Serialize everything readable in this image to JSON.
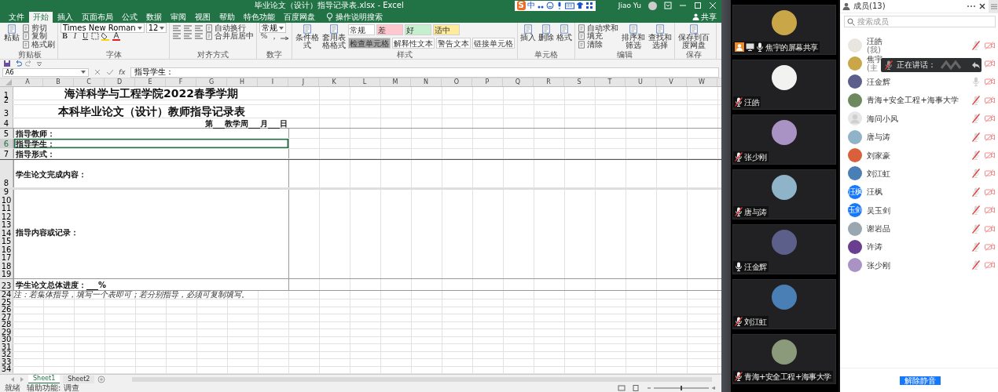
{
  "excel": {
    "title": "毕业论文（设计）指导记录表.xlsx - Excel",
    "ime": {
      "logo": "S",
      "mode": "中"
    },
    "user": "Jiao Yu",
    "share": "共享",
    "tabs": [
      {
        "label": "文件",
        "selected": false
      },
      {
        "label": "开始",
        "selected": true
      },
      {
        "label": "插入",
        "selected": false
      },
      {
        "label": "页面布局",
        "selected": false
      },
      {
        "label": "公式",
        "selected": false
      },
      {
        "label": "数据",
        "selected": false
      },
      {
        "label": "审阅",
        "selected": false
      },
      {
        "label": "视图",
        "selected": false
      },
      {
        "label": "帮助",
        "selected": false
      },
      {
        "label": "特色功能",
        "selected": false
      },
      {
        "label": "百度网盘",
        "selected": false
      }
    ],
    "tell_me": "操作说明搜索",
    "ribbon": [
      {
        "label": "剪贴板",
        "kind": "clipboard",
        "items": [
          {
            "kind": "large",
            "label": "粘贴"
          },
          {
            "kind": "stack",
            "lines": [
              [
                {
                  "kind": "small",
                  "label": "剪切"
                }
              ],
              [
                {
                  "kind": "small",
                  "label": "复制"
                }
              ],
              [
                {
                  "kind": "small",
                  "label": "格式刷"
                }
              ]
            ]
          }
        ]
      },
      {
        "label": "字体",
        "kind": "font",
        "items": [
          {
            "kind": "stack",
            "lines": [
              [
                {
                  "kind": "field",
                  "label": "Times New Roman"
                },
                {
                  "kind": "field",
                  "label": "12"
                }
              ],
              [
                {
                  "kind": "format",
                  "label": "B"
                },
                {
                  "kind": "format",
                  "label": "I"
                },
                {
                  "kind": "format",
                  "label": "U"
                }
              ]
            ]
          }
        ]
      },
      {
        "label": "对齐方式",
        "kind": "alignment",
        "items": [
          {
            "kind": "stack",
            "lines": [
              [
                {
                  "kind": "small",
                  "label": "自动换行"
                }
              ],
              [
                {
                  "kind": "small",
                  "label": "合并后居中"
                }
              ]
            ]
          }
        ]
      },
      {
        "label": "数字",
        "kind": "number",
        "items": [
          {
            "kind": "stack",
            "lines": [
              [
                {
                  "kind": "field",
                  "label": "常规"
                }
              ],
              [
                {
                  "kind": "format",
                  "label": "%"
                },
                {
                  "kind": "format",
                  "label": ","
                }
              ]
            ]
          }
        ]
      },
      {
        "label": "样式",
        "kind": "styles",
        "items": [
          {
            "kind": "large",
            "label": "条件格式"
          },
          {
            "kind": "large",
            "label": "套用表格格式"
          },
          {
            "kind": "stack",
            "lines": [
              [
                {
                  "kind": "style",
                  "label": "常规",
                  "color": "#ffffff"
                },
                {
                  "kind": "style",
                  "label": "差",
                  "color": "#ffc7ce"
                },
                {
                  "kind": "style",
                  "label": "好",
                  "color": "#c6efce"
                },
                {
                  "kind": "style",
                  "label": "适中",
                  "color": "#ffeb9c"
                }
              ],
              [
                {
                  "kind": "style",
                  "label": "检查单元格",
                  "color": "#a5a5a5"
                },
                {
                  "kind": "style",
                  "label": "解释性文本",
                  "color": "#ffffff"
                },
                {
                  "kind": "style",
                  "label": "警告文本",
                  "color": "#ffffff"
                },
                {
                  "kind": "style",
                  "label": "链接单元格",
                  "color": "#ffffff"
                }
              ]
            ]
          }
        ]
      },
      {
        "label": "单元格",
        "kind": "cells",
        "items": [
          {
            "kind": "large",
            "label": "插入"
          },
          {
            "kind": "large",
            "label": "删除"
          },
          {
            "kind": "large",
            "label": "格式"
          }
        ]
      },
      {
        "label": "编辑",
        "kind": "editing",
        "items": [
          {
            "kind": "stack",
            "lines": [
              [
                {
                  "kind": "small",
                  "label": "自动求和"
                }
              ],
              [
                {
                  "kind": "small",
                  "label": "填充"
                }
              ],
              [
                {
                  "kind": "small",
                  "label": "清除"
                }
              ]
            ]
          },
          {
            "kind": "large",
            "label": "排序和筛选"
          },
          {
            "kind": "large",
            "label": "查找和选择"
          }
        ]
      },
      {
        "label": "保存",
        "kind": "save",
        "items": [
          {
            "kind": "large",
            "label": "保存到百度网盘"
          }
        ]
      }
    ],
    "name_box": "A6",
    "function_label": "fx",
    "formula": "指导学生：",
    "columns": [
      "A",
      "B",
      "C",
      "D",
      "E",
      "F",
      "G",
      "H",
      "I",
      "J",
      "K",
      "L",
      "M",
      "N",
      "O",
      "P",
      "Q",
      "R",
      "S",
      "T",
      "U",
      "V",
      "W"
    ],
    "rows": [
      {
        "number": "1",
        "kind": "title",
        "text": "海洋科学与工程学院2022春季学期",
        "selected": false
      },
      {
        "number": "2",
        "kind": "spacer",
        "selected": false
      },
      {
        "number": "3",
        "kind": "title",
        "text": "本科毕业论文（设计）教师指导记录表",
        "selected": false
      },
      {
        "number": "4",
        "kind": "date",
        "text": "第___教学周___月___日",
        "selected": false
      },
      {
        "number": "5",
        "kind": "field",
        "text": "指导教师：",
        "selected": false
      },
      {
        "number": "6",
        "kind": "field",
        "text": "指导学生：",
        "selected": true
      },
      {
        "number": "7",
        "kind": "field",
        "text": "指导形式：",
        "selected": false
      },
      {
        "number": "8",
        "kind": "section",
        "text": "学生论文完成内容：",
        "selected": false
      },
      {
        "number": "9",
        "kind": "body-top",
        "selected": false
      },
      {
        "number": "10",
        "kind": "body",
        "selected": false
      },
      {
        "number": "11",
        "kind": "body",
        "selected": false
      },
      {
        "number": "12",
        "kind": "body",
        "selected": false
      },
      {
        "number": "13",
        "kind": "body",
        "selected": false
      },
      {
        "number": "14",
        "kind": "body",
        "text": "指导内容或记录：",
        "selected": false
      },
      {
        "number": "15",
        "kind": "body",
        "selected": false
      },
      {
        "number": "16",
        "kind": "body",
        "selected": false
      },
      {
        "number": "17",
        "kind": "body",
        "selected": false
      },
      {
        "number": "18",
        "kind": "body",
        "selected": false
      },
      {
        "number": "19",
        "kind": "body",
        "selected": false
      },
      {
        "number": "23",
        "kind": "progress",
        "text": "学生论文总体进度：___%",
        "selected": false
      },
      {
        "number": "24",
        "kind": "note",
        "text": "注：若集体指导，填写一个表即可；若分别指导，必须可复制填写。",
        "selected": false
      },
      {
        "number": "25",
        "kind": "plain",
        "selected": false
      },
      {
        "number": "26",
        "kind": "plain",
        "selected": false
      },
      {
        "number": "27",
        "kind": "plain",
        "selected": false
      },
      {
        "number": "28",
        "kind": "plain",
        "selected": false
      },
      {
        "number": "29",
        "kind": "plain",
        "selected": false
      },
      {
        "number": "30",
        "kind": "plain",
        "selected": false
      },
      {
        "number": "31",
        "kind": "plain",
        "selected": false
      },
      {
        "number": "32",
        "kind": "plain",
        "selected": false
      },
      {
        "number": "33",
        "kind": "plain",
        "selected": false
      },
      {
        "number": "34",
        "kind": "plain",
        "selected": false
      }
    ],
    "sheet_tabs": [
      {
        "label": "Sheet1",
        "selected": true
      },
      {
        "label": "Sheet2",
        "selected": false
      }
    ],
    "status": "就绪",
    "accessibility": "辅助功能: 调查"
  },
  "video_tiles": [
    {
      "name": "焦宇的屏幕共享",
      "mic_on": true,
      "sharing": true,
      "color": "#c9a648"
    },
    {
      "name": "汪皓",
      "mic_on": false,
      "sharing": false,
      "color": "#f2f2f0"
    },
    {
      "name": "张少刚",
      "mic_on": false,
      "sharing": false,
      "color": "#a993c4"
    },
    {
      "name": "唐与涛",
      "mic_on": false,
      "sharing": false,
      "color": "#8fb3c9"
    },
    {
      "name": "汪金辉",
      "mic_on": true,
      "sharing": false,
      "color": "#5c5f8a"
    },
    {
      "name": "刘江虹",
      "mic_on": false,
      "sharing": false,
      "color": "#4a7fb5"
    },
    {
      "name": "青海+安全工程+海事大学",
      "mic_on": false,
      "sharing": false,
      "color": "#8a9a7a"
    }
  ],
  "members_panel": {
    "title": "成员(13)",
    "search": {
      "placeholder": "搜索成员"
    },
    "members": [
      {
        "name": "汪皓",
        "note": "(我)",
        "avatar": {
          "kind": "photo",
          "color": "#e9e6df"
        },
        "muted": true,
        "camera_on": false
      },
      {
        "name": "焦宇",
        "note": "(主",
        "avatar": {
          "kind": "photo",
          "color": "#c9a648"
        },
        "camera_on": false
      },
      {
        "name": "汪金辉",
        "avatar": {
          "kind": "photo",
          "color": "#5c5f8a"
        },
        "muted": false,
        "camera_on": false
      },
      {
        "name": "青海+安全工程+海事大学",
        "avatar": {
          "kind": "photo",
          "color": "#6d8a5e"
        },
        "muted": true,
        "camera_on": false
      },
      {
        "name": "海问小风",
        "avatar": {
          "kind": "default"
        },
        "muted": true,
        "camera_on": false
      },
      {
        "name": "唐与涛",
        "avatar": {
          "kind": "photo",
          "color": "#8fb3c9"
        },
        "muted": true,
        "camera_on": false
      },
      {
        "name": "刘家豪",
        "avatar": {
          "kind": "photo",
          "color": "#d9603a"
        },
        "muted": true,
        "camera_on": false
      },
      {
        "name": "刘江虹",
        "avatar": {
          "kind": "photo",
          "color": "#4a7fb5"
        },
        "muted": true,
        "camera_on": false
      },
      {
        "name": "汪枫",
        "avatar": {
          "kind": "text",
          "text": "汪枫",
          "color": "#1677ff"
        },
        "muted": true,
        "camera_on": false
      },
      {
        "name": "吴玉剑",
        "avatar": {
          "kind": "text",
          "text": "玉剑",
          "color": "#1677ff"
        },
        "muted": true,
        "camera_on": false
      },
      {
        "name": "谢岩品",
        "avatar": {
          "kind": "photo",
          "color": "#9aa7b0"
        },
        "muted": true,
        "camera_on": false
      },
      {
        "name": "许涛",
        "avatar": {
          "kind": "photo",
          "color": "#6a3f8f"
        },
        "muted": true,
        "camera_on": false
      },
      {
        "name": "张少刚",
        "avatar": {
          "kind": "photo",
          "color": "#a993c4"
        },
        "muted": true,
        "camera_on": false
      }
    ],
    "speaking_tooltip": {
      "text": "正在讲话："
    },
    "unmute_button": "解除静音"
  }
}
